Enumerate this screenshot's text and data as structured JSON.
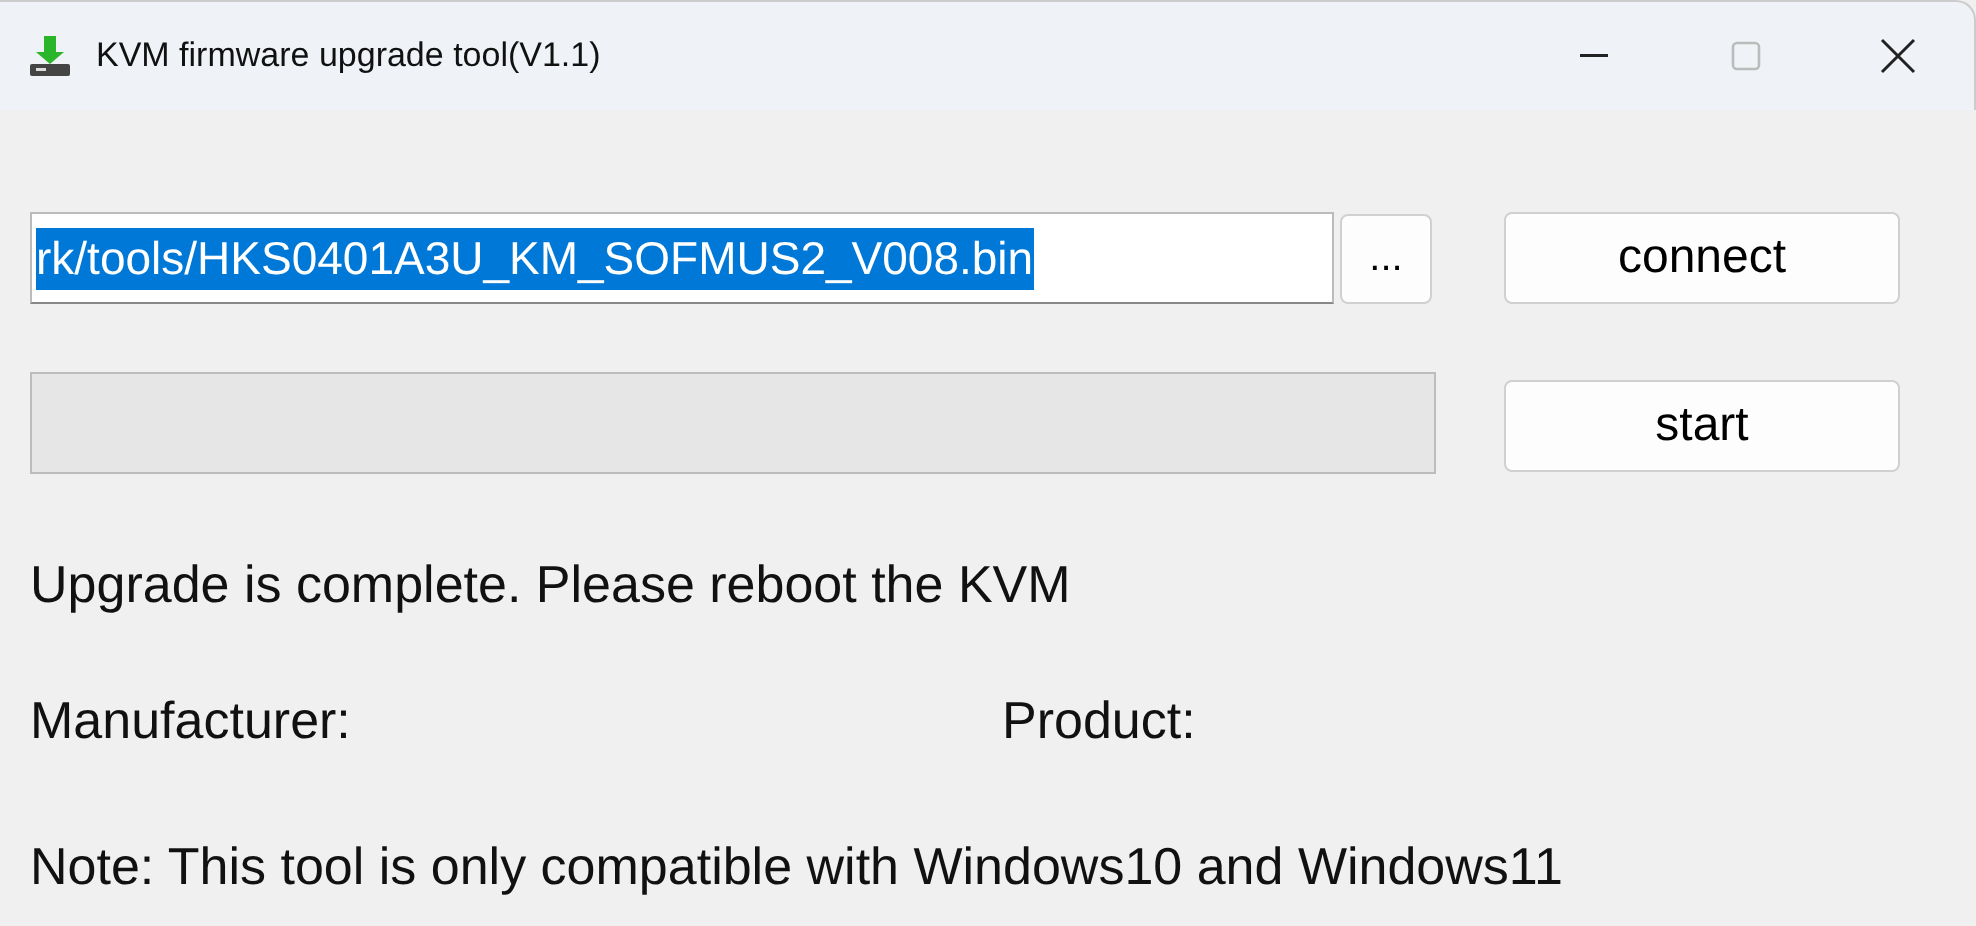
{
  "window": {
    "title": "KVM firmware upgrade tool(V1.1)",
    "controls": [
      {
        "kind": "minimize",
        "disabled": false
      },
      {
        "kind": "maximize",
        "disabled": true
      },
      {
        "kind": "close",
        "disabled": false
      }
    ]
  },
  "file_field": {
    "value": "rk/tools/HKS0401A3U_KM_SOFMUS2_V008.bin",
    "selected": true
  },
  "browse_button": "...",
  "connect_button": "connect",
  "progress": {
    "level": 0
  },
  "start_button": "start",
  "status": "Upgrade is complete. Please reboot the KVM",
  "manufacturer_label": "Manufacturer:",
  "product_label": "Product:",
  "note": "Note: This tool is only compatible with Windows10 and Windows11"
}
